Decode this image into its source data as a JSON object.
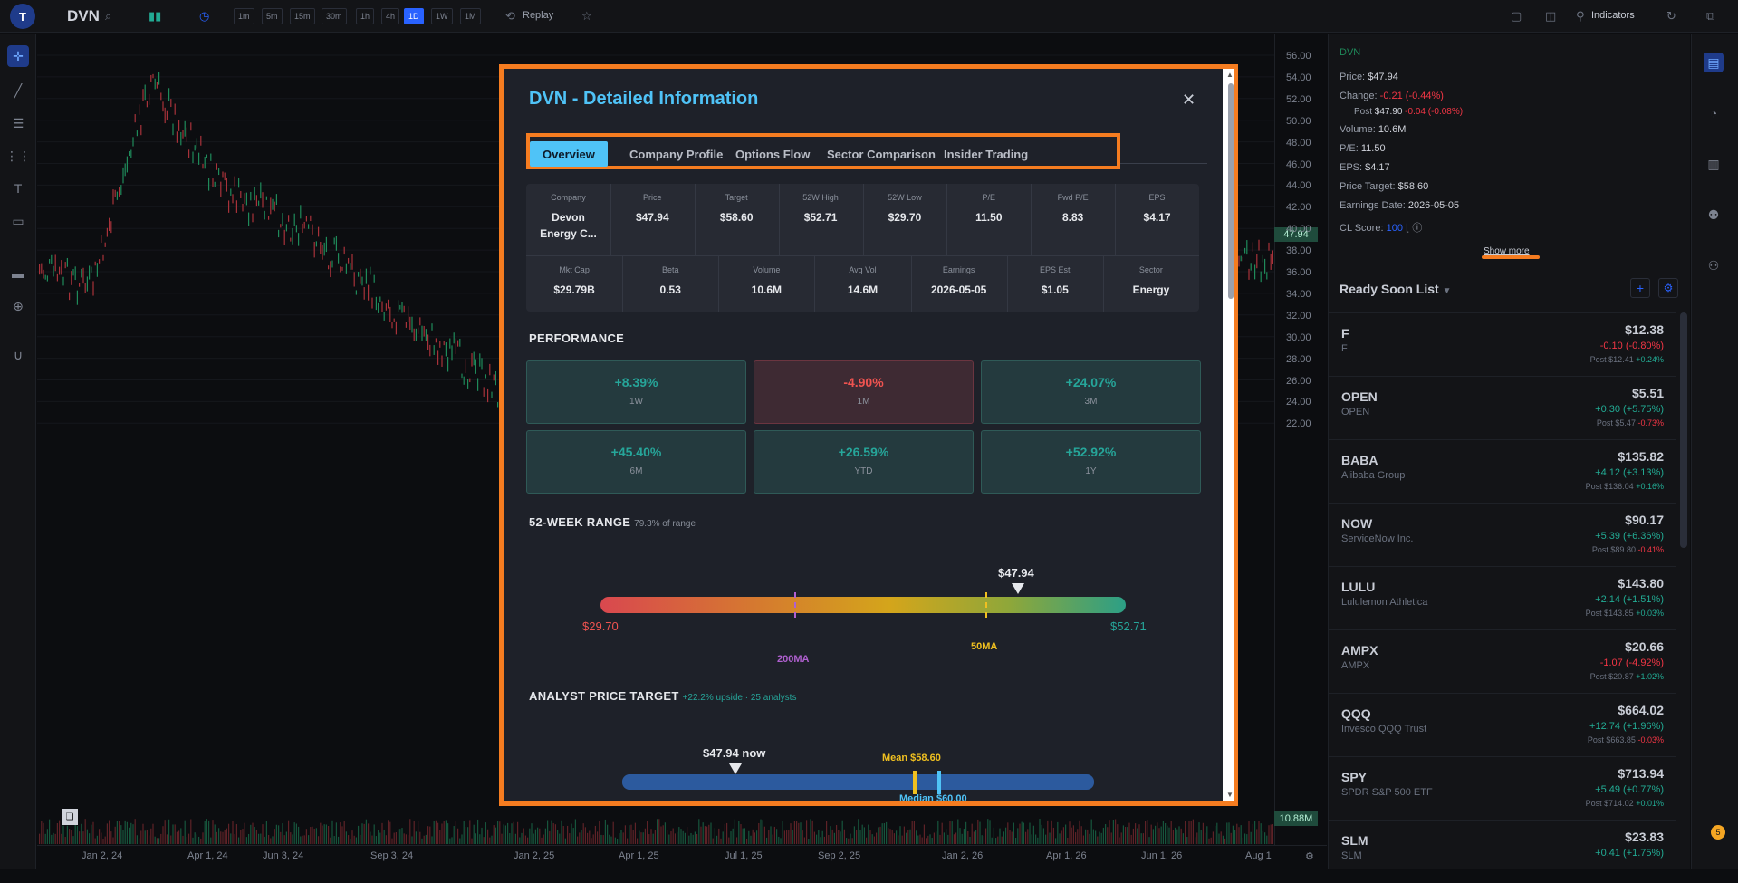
{
  "topbar": {
    "avatar": "T",
    "symbol": "DVN",
    "timeframes": [
      "1m",
      "5m",
      "15m",
      "30m",
      "1h",
      "4h",
      "1D",
      "1W",
      "1M"
    ],
    "active_timeframe": "1D",
    "replay": "Replay",
    "indicators": "Indicators"
  },
  "chart": {
    "price_labels": [
      "56.00",
      "54.00",
      "52.00",
      "50.00",
      "48.00",
      "46.00",
      "44.00",
      "42.00",
      "40.00",
      "38.00",
      "36.00",
      "34.00",
      "32.00",
      "30.00",
      "28.00",
      "26.00",
      "24.00",
      "22.00"
    ],
    "last_price": "47.94",
    "volume_badge": "10.88M",
    "time_labels": [
      "Jan 2, 24",
      "Apr 1, 24",
      "Jun 3, 24",
      "Sep 3, 24",
      "Jan 2, 25",
      "Apr 1, 25",
      "Jul 1, 25",
      "Sep 2, 25",
      "Jan 2, 26",
      "Apr 1, 26",
      "Jun 1, 26",
      "Aug 1"
    ]
  },
  "side_panel": {
    "symbol": "DVN",
    "price_label": "Price:",
    "price": "$47.94",
    "change_label": "Change:",
    "change": "-0.21 (-0.44%)",
    "post_label": "Post",
    "post": "$47.90",
    "post_change": "-0.04 (-0.08%)",
    "volume_label": "Volume:",
    "volume": "10.6M",
    "pe_label": "P/E:",
    "pe": "11.50",
    "eps_label": "EPS:",
    "eps": "$4.17",
    "target_label": "Price Target:",
    "target": "$58.60",
    "earnings_label": "Earnings Date:",
    "earnings": "2026-05-05",
    "cl_label": "CL Score:",
    "cl": "100",
    "show_more": "Show more"
  },
  "ready_soon": {
    "title": "Ready Soon List",
    "items": [
      {
        "sym": "F",
        "name": "F",
        "price": "$12.38",
        "chg": "-0.10 (-0.80%)",
        "dir": "red",
        "post": "Post",
        "post_price": "$12.41",
        "post_chg": "+0.24%",
        "post_dir": "green"
      },
      {
        "sym": "OPEN",
        "name": "OPEN",
        "price": "$5.51",
        "chg": "+0.30 (+5.75%)",
        "dir": "green",
        "post": "Post",
        "post_price": "$5.47",
        "post_chg": "-0.73%",
        "post_dir": "red"
      },
      {
        "sym": "BABA",
        "name": "Alibaba Group",
        "price": "$135.82",
        "chg": "+4.12 (+3.13%)",
        "dir": "green",
        "post": "Post",
        "post_price": "$136.04",
        "post_chg": "+0.16%",
        "post_dir": "green"
      },
      {
        "sym": "NOW",
        "name": "ServiceNow Inc.",
        "price": "$90.17",
        "chg": "+5.39 (+6.36%)",
        "dir": "green",
        "post": "Post",
        "post_price": "$89.80",
        "post_chg": "-0.41%",
        "post_dir": "red"
      },
      {
        "sym": "LULU",
        "name": "Lululemon Athletica",
        "price": "$143.80",
        "chg": "+2.14 (+1.51%)",
        "dir": "green",
        "post": "Post",
        "post_price": "$143.85",
        "post_chg": "+0.03%",
        "post_dir": "green"
      },
      {
        "sym": "AMPX",
        "name": "AMPX",
        "price": "$20.66",
        "chg": "-1.07 (-4.92%)",
        "dir": "red",
        "post": "Post",
        "post_price": "$20.87",
        "post_chg": "+1.02%",
        "post_dir": "green"
      },
      {
        "sym": "QQQ",
        "name": "Invesco QQQ Trust",
        "price": "$664.02",
        "chg": "+12.74 (+1.96%)",
        "dir": "green",
        "post": "Post",
        "post_price": "$663.85",
        "post_chg": "-0.03%",
        "post_dir": "red"
      },
      {
        "sym": "SPY",
        "name": "SPDR S&P 500 ETF",
        "price": "$713.94",
        "chg": "+5.49 (+0.77%)",
        "dir": "green",
        "post": "Post",
        "post_price": "$714.02",
        "post_chg": "+0.01%",
        "post_dir": "green"
      },
      {
        "sym": "SLM",
        "name": "SLM",
        "price": "$23.83",
        "chg": "+0.41 (+1.75%)",
        "dir": "green",
        "post": "",
        "post_price": "",
        "post_chg": "",
        "post_dir": "green"
      }
    ]
  },
  "modal": {
    "title": "DVN - Detailed Information",
    "close": "✕",
    "tabs": [
      "Overview",
      "Company Profile",
      "Options Flow",
      "Sector Comparison",
      "Insider Trading"
    ],
    "active_tab": "Overview",
    "info_row1": [
      {
        "label": "Company",
        "value": "Devon Energy C..."
      },
      {
        "label": "Price",
        "value": "$47.94"
      },
      {
        "label": "Target",
        "value": "$58.60"
      },
      {
        "label": "52W High",
        "value": "$52.71"
      },
      {
        "label": "52W Low",
        "value": "$29.70"
      },
      {
        "label": "P/E",
        "value": "11.50"
      },
      {
        "label": "Fwd P/E",
        "value": "8.83"
      },
      {
        "label": "EPS",
        "value": "$4.17"
      }
    ],
    "info_row2": [
      {
        "label": "Mkt Cap",
        "value": "$29.79B"
      },
      {
        "label": "Beta",
        "value": "0.53"
      },
      {
        "label": "Volume",
        "value": "10.6M"
      },
      {
        "label": "Avg Vol",
        "value": "14.6M"
      },
      {
        "label": "Earnings",
        "value": "2026-05-05"
      },
      {
        "label": "EPS Est",
        "value": "$1.05"
      },
      {
        "label": "Sector",
        "value": "Energy"
      }
    ],
    "performance_title": "PERFORMANCE",
    "performance": [
      {
        "value": "+8.39%",
        "label": "1W",
        "dir": "pos"
      },
      {
        "value": "-4.90%",
        "label": "1M",
        "dir": "neg"
      },
      {
        "value": "+24.07%",
        "label": "3M",
        "dir": "pos"
      },
      {
        "value": "+45.40%",
        "label": "6M",
        "dir": "pos"
      },
      {
        "value": "+26.59%",
        "label": "YTD",
        "dir": "pos"
      },
      {
        "value": "+52.92%",
        "label": "1Y",
        "dir": "pos"
      }
    ],
    "range_title": "52-WEEK RANGE",
    "range_sub": "79.3% of range",
    "range_position": 0.793,
    "range_current": "$47.94",
    "range_low": "$29.70",
    "range_high": "$52.71",
    "ma200_label": "200MA",
    "ma50_label": "50MA",
    "target_title": "ANALYST PRICE TARGET",
    "target_sub": "+22.2% upside · 25 analysts",
    "target_now": "$47.94 now",
    "target_mean": "Mean $58.60",
    "target_median": "Median $60.00"
  },
  "colors": {
    "accent": "#4fc3f7",
    "highlight": "#f57c20",
    "positive": "#22ab94",
    "negative": "#f23645"
  }
}
